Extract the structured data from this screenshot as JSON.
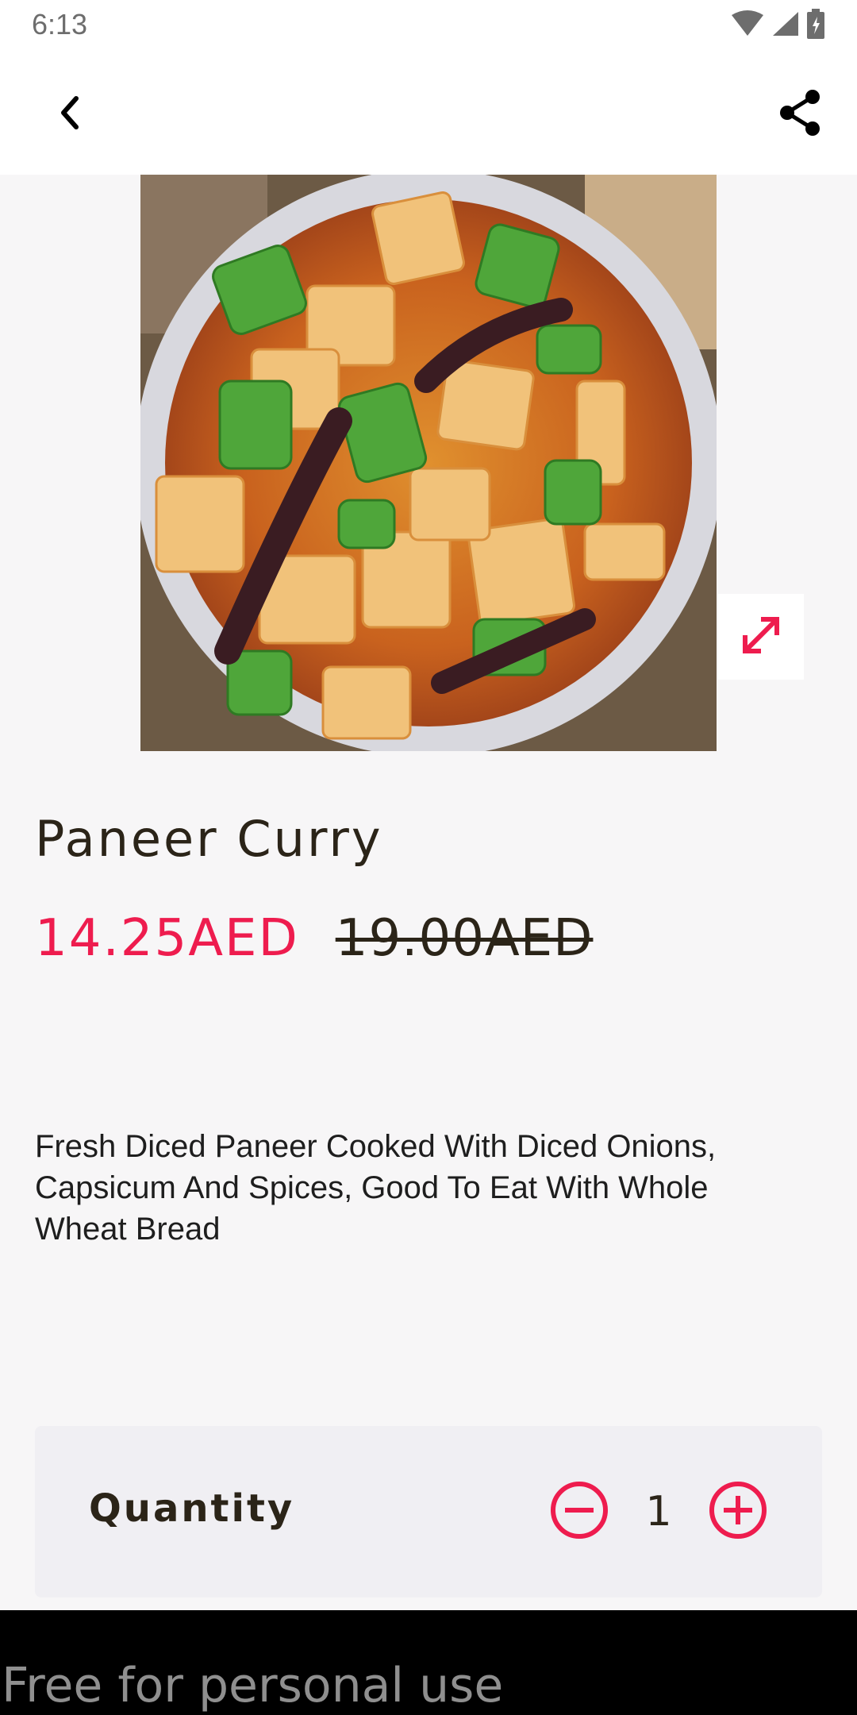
{
  "status_bar": {
    "time": "6:13",
    "icons": [
      "wifi-icon",
      "signal-icon",
      "battery-icon"
    ]
  },
  "toolbar": {
    "back_icon": "chevron-left-icon",
    "share_icon": "share-icon"
  },
  "product": {
    "name": "Paneer Curry",
    "price_current": "14.25AED",
    "price_original": "19.00AED",
    "description": "Fresh Diced Paneer Cooked With Diced Onions, Capsicum And Spices, Good To Eat With Whole Wheat Bread",
    "expand_icon": "expand-diagonal-icon"
  },
  "quantity": {
    "label": "Quantity",
    "value": "1",
    "minus_icon": "minus-circle-icon",
    "plus_icon": "plus-circle-icon"
  },
  "footer": {
    "watermark": "Free for personal use"
  },
  "colors": {
    "accent": "#ee1c4e",
    "text_dark": "#2b2418",
    "background": "#f7f6f7",
    "card": "#f0eff3"
  }
}
